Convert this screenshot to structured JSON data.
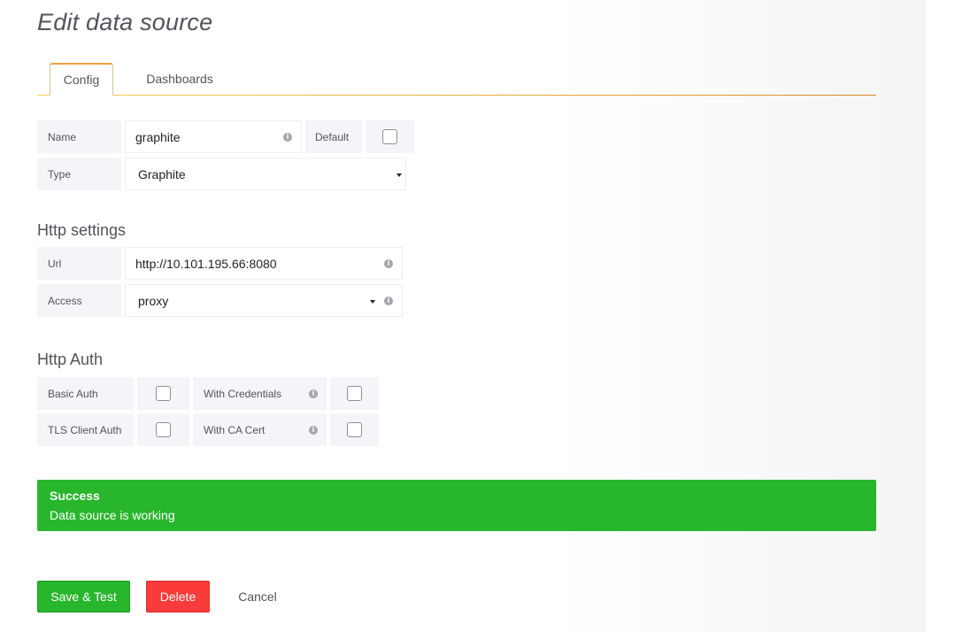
{
  "page": {
    "title": "Edit data source"
  },
  "tabs": [
    {
      "label": "Config",
      "active": true
    },
    {
      "label": "Dashboards",
      "active": false
    }
  ],
  "config": {
    "name_label": "Name",
    "name_value": "graphite",
    "default_label": "Default",
    "default_checked": false,
    "type_label": "Type",
    "type_value": "Graphite"
  },
  "http": {
    "title": "Http settings",
    "url_label": "Url",
    "url_value": "http://10.101.195.66:8080",
    "access_label": "Access",
    "access_value": "proxy"
  },
  "auth": {
    "title": "Http Auth",
    "basic_label": "Basic Auth",
    "basic_checked": false,
    "credentials_label": "With Credentials",
    "credentials_checked": false,
    "tls_label": "TLS Client Auth",
    "tls_checked": false,
    "ca_label": "With CA Cert",
    "ca_checked": false
  },
  "alert": {
    "title": "Success",
    "message": "Data source is working",
    "color": "#28b62c"
  },
  "buttons": {
    "save": "Save & Test",
    "delete": "Delete",
    "cancel": "Cancel"
  },
  "colors": {
    "success": "#28b62c",
    "danger": "#fb3a3a",
    "tab_accent": "#f2a03d"
  },
  "icons": {
    "info": "info-circle-icon",
    "caret": "caret-down-icon"
  }
}
